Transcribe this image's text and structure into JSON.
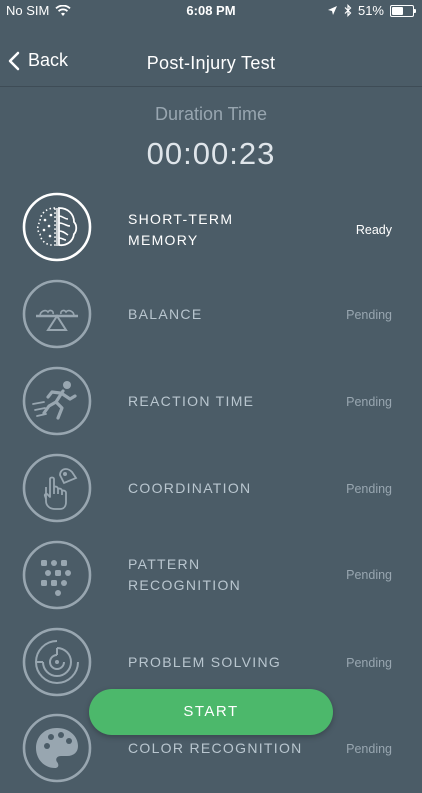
{
  "status_bar": {
    "carrier": "No SIM",
    "time": "6:08 PM",
    "battery_percent": "51%",
    "battery_level": 0.51
  },
  "nav": {
    "back_label": "Back",
    "title": "Post-Injury Test"
  },
  "duration": {
    "label": "Duration Time",
    "value": "00:00:23"
  },
  "tests": [
    {
      "label": "SHORT-TERM\nMEMORY",
      "status": "Ready",
      "icon": "brain-icon",
      "active": true
    },
    {
      "label": "BALANCE",
      "status": "Pending",
      "icon": "balance-board-icon",
      "active": false
    },
    {
      "label": "REACTION TIME",
      "status": "Pending",
      "icon": "runner-icon",
      "active": false
    },
    {
      "label": "COORDINATION",
      "status": "Pending",
      "icon": "hand-tap-icon",
      "active": false
    },
    {
      "label": "PATTERN\nRECOGNITION",
      "status": "Pending",
      "icon": "grid-pattern-icon",
      "active": false
    },
    {
      "label": "PROBLEM SOLVING",
      "status": "Pending",
      "icon": "maze-icon",
      "active": false
    },
    {
      "label": "COLOR RECOGNITION",
      "status": "Pending",
      "icon": "palette-icon",
      "active": false
    }
  ],
  "start_button": {
    "label": "START"
  },
  "colors": {
    "background": "#4b5c67",
    "accent": "#4cb86b",
    "muted": "#98a6b0"
  }
}
